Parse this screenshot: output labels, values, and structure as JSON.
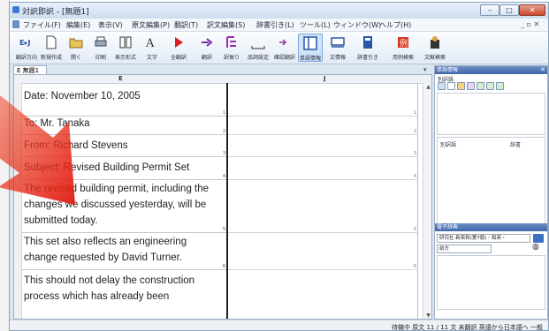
{
  "window": {
    "title": "対訳即訳 - [無題1]",
    "controls": [
      "–",
      "□",
      "✕"
    ]
  },
  "menubar": {
    "items": [
      "ファイル(F)",
      "編集(E)",
      "表示(V)",
      "原文編集(P)",
      "翻訳(T)",
      "訳文編集(S)",
      "辞書引き(L)",
      "ツール(L)",
      "ウィンドウ(W)",
      "ヘルプ(H)"
    ]
  },
  "toolbar": {
    "items": [
      {
        "label": "翻訳方向",
        "icon": "direction-icon"
      },
      {
        "label": "新規作成",
        "icon": "new-doc-icon"
      },
      {
        "label": "開く",
        "icon": "open-icon"
      },
      {
        "label": "印刷",
        "icon": "print-icon"
      },
      {
        "label": "表示形式",
        "icon": "view-icon"
      },
      {
        "label": "文字",
        "icon": "font-icon"
      },
      {
        "label": "全翻訳",
        "icon": "translate-all-icon"
      },
      {
        "label": "翻訳",
        "icon": "translate-icon"
      },
      {
        "label": "訳振り",
        "icon": "furigana-icon"
      },
      {
        "label": "品詞設定",
        "icon": "pos-icon"
      },
      {
        "label": "確認翻訳",
        "icon": "confirm-icon"
      },
      {
        "label": "単語情報",
        "icon": "word-info-icon"
      },
      {
        "label": "文情報",
        "icon": "sentence-info-icon"
      },
      {
        "label": "辞書引き",
        "icon": "dictionary-icon"
      },
      {
        "label": "用例検索",
        "icon": "example-search-icon"
      },
      {
        "label": "文献検索",
        "icon": "literature-icon"
      }
    ]
  },
  "document": {
    "tab_label": "E 無題1",
    "columns": {
      "source": "E",
      "target": "J"
    },
    "segments": [
      {
        "text": "Date: November 10, 2005",
        "num": "1"
      },
      {
        "text": "To: Mr. Tanaka",
        "num": "2"
      },
      {
        "text": "From: Richard Stevens",
        "num": "3"
      },
      {
        "text": "Subject: Revised Building Permit Set",
        "num": "4"
      },
      {
        "text": "The revised building permit, including the changes we discussed yesterday, will be submitted today.",
        "num": "5"
      },
      {
        "text": "This set also reflects an engineering change requested by David Turner.",
        "num": "6"
      },
      {
        "text": "This should not delay the construction process which has already been",
        "num": ""
      }
    ],
    "target_segments": [
      {
        "num": "1"
      },
      {
        "num": "2"
      },
      {
        "num": "3"
      },
      {
        "num": "4"
      },
      {
        "num": "5"
      },
      {
        "num": "6"
      }
    ]
  },
  "right_panel": {
    "title": "単語情報",
    "section_label": "別訳語",
    "columns": [
      "別訳語",
      "辞書"
    ],
    "dictionary": {
      "title": "電子辞典",
      "selector": "研究社 新英和(第7版)・和英・",
      "direction": "前方"
    }
  },
  "statusbar": {
    "text": "待機中  原文  11 / 11 文  未翻訳  英語から日本語へ  一般"
  },
  "colors": {
    "arrow": "#e8251a",
    "title_gradient_top": "#e9f1fb",
    "accent": "#3f66a8"
  }
}
